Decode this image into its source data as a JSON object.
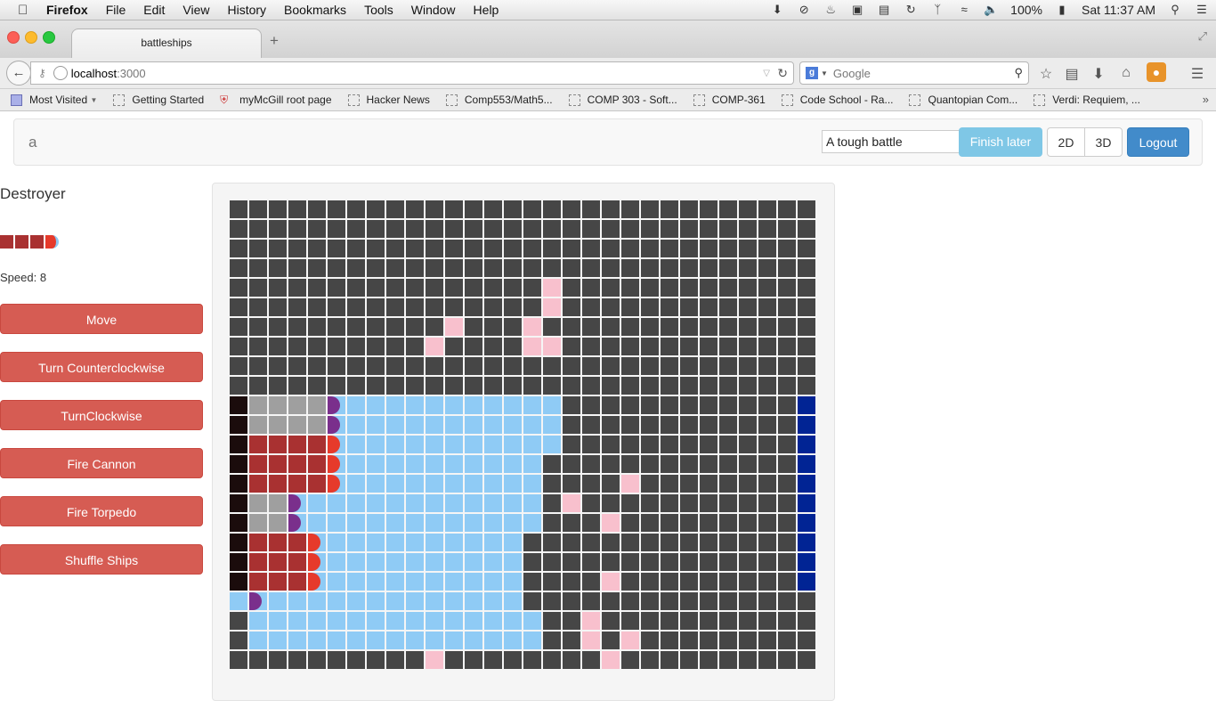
{
  "menubar": {
    "app": "Firefox",
    "items": [
      "File",
      "Edit",
      "View",
      "History",
      "Bookmarks",
      "Tools",
      "Window",
      "Help"
    ],
    "battery": "100%",
    "clock": "Sat 11:37 AM"
  },
  "browser": {
    "tab_title": "battleships",
    "url_host": "localhost",
    "url_port": ":3000",
    "search_placeholder": "Google",
    "bookmarks": [
      "Most Visited",
      "Getting Started",
      "myMcGill root page",
      "Hacker News",
      "Comp553/Math5...",
      "COMP 303 - Soft...",
      "COMP-361",
      "Code School - Ra...",
      "Quantopian Com...",
      "Verdi: Requiem, ..."
    ]
  },
  "appnav": {
    "brand": "a",
    "battle_name": "A tough battle",
    "finish_label": "Finish later",
    "btn2d_label": "2D",
    "btn3d_label": "3D",
    "logout_label": "Logout"
  },
  "sidebar": {
    "ship_name": "Destroyer",
    "speed": "Speed: 8",
    "buttons": [
      "Move",
      "Turn Counterclockwise",
      "TurnClockwise",
      "Fire Cannon",
      "Fire Torpedo",
      "Shuffle Ships"
    ]
  },
  "board": {
    "colors": {
      "fog": "#464646",
      "water": "#8fcbf5",
      "hit": "#f8c0cd",
      "base": "#1b0c0c",
      "coral": "#012494",
      "ship": "#a93131",
      "ship_head": "#e63a2b",
      "armor": "#9f9f9f",
      "armor_head": "#7a2f8c"
    },
    "rows": [
      "..............................",
      "..............................",
      "..............................",
      "..............................",
      "..............................",
      "..............................",
      "..............................",
      "..............................",
      "..............................",
      "..............................",
      "BAAAAgwwwwwwwwwww............C",
      "BAAAAgwwwwwwwwwww............C",
      "BRRRRrwwwwwwwwwww............C",
      "BRRRRrwwwwwwwwww.............C",
      "BRRRRrwwwwwwwwww.............C",
      "BAAgwwwwwwwwwwww.............C",
      "BAAgwwwwwwwwwwww.............C",
      "BRRRrwwwwwwwwww..............C",
      "BRRRrwwwwwwwwww..............C",
      "BRRRrwwwwwwwwww..............C",
      "wgwwwwwwwwwwwww...............",
      ".wwwwwwwwwwwwwww..............",
      ".wwwwwwwwwwwwwww..............",
      ".............................."
    ]
  }
}
